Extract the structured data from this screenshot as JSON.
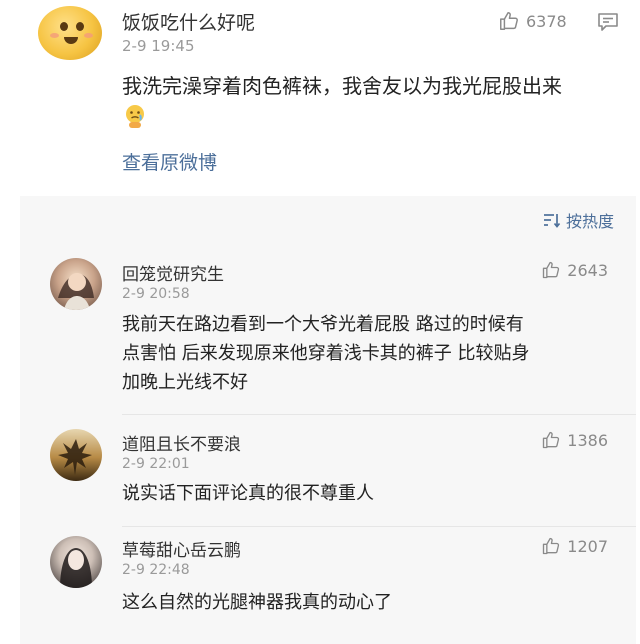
{
  "post": {
    "username": "饭饭吃什么好呢",
    "time": "2-9 19:45",
    "likes": "6378",
    "text": "我洗完澡穿着肉色裤袜，我舍友以为我光屁股出来",
    "view_original": "查看原微博"
  },
  "replies_header": {
    "sort_label": "按热度"
  },
  "replies": [
    {
      "username": "回笼觉研究生",
      "time": "2-9 20:58",
      "likes": "2643",
      "lines": [
        "我前天在路边看到一个大爷光着屁股 路过的时候有",
        "点害怕 后来发现原来他穿着浅卡其的裤子 比较贴身",
        "加晚上光线不好"
      ]
    },
    {
      "username": "道阻且长不要浪",
      "time": "2-9 22:01",
      "likes": "1386",
      "lines": [
        "说实话下面评论真的很不尊重人"
      ]
    },
    {
      "username": "草莓甜心岳云鹏",
      "time": "2-9 22:48",
      "likes": "1207",
      "lines": [
        "这么自然的光腿神器我真的动心了"
      ]
    }
  ],
  "colors": {
    "link": "#4c6f9a",
    "muted": "#9a9a9a",
    "reply_bg": "#f7f7f7"
  }
}
